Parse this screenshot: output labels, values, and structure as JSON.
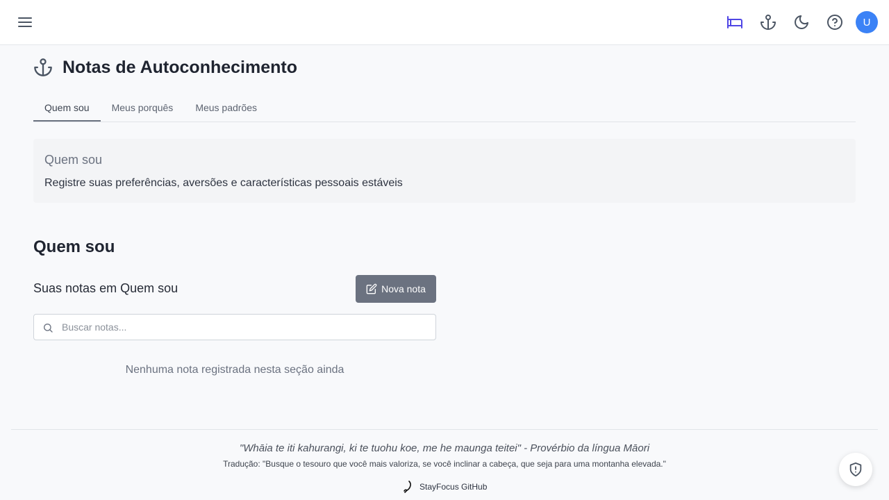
{
  "header": {
    "menu_icon": "hamburger-menu-icon",
    "icons": [
      "bed-icon",
      "anchor-icon",
      "moon-icon",
      "help-icon"
    ],
    "avatar_initial": "U",
    "avatar_color": "#3b82f6",
    "active_icon_color": "#4f46e5"
  },
  "page": {
    "title_icon": "anchor-icon",
    "title": "Notas de Autoconhecimento"
  },
  "tabs": [
    {
      "label": "Quem sou",
      "active": true
    },
    {
      "label": "Meus porquês",
      "active": false
    },
    {
      "label": "Meus padrões",
      "active": false
    }
  ],
  "info_card": {
    "title": "Quem sou",
    "description": "Registre suas preferências, aversões e características pessoais estáveis"
  },
  "section": {
    "title": "Quem sou",
    "notes_label": "Suas notas em Quem sou",
    "new_note_label": "Nova nota",
    "search_placeholder": "Buscar notas...",
    "empty_message": "Nenhuma nota registrada nesta seção ainda"
  },
  "footer": {
    "quote": "\"Whāia te iti kahurangi, ki te tuohu koe, me he maunga teitei\" - Provérbio da língua Māori",
    "translation": "Tradução: \"Busque o tesouro que você mais valoriza, se você inclinar a cabeça, que seja para uma montanha elevada.\"",
    "github_label": "StayFocus GitHub"
  },
  "colors": {
    "button_bg": "#6b7280",
    "page_bg": "#f8f9fb"
  }
}
